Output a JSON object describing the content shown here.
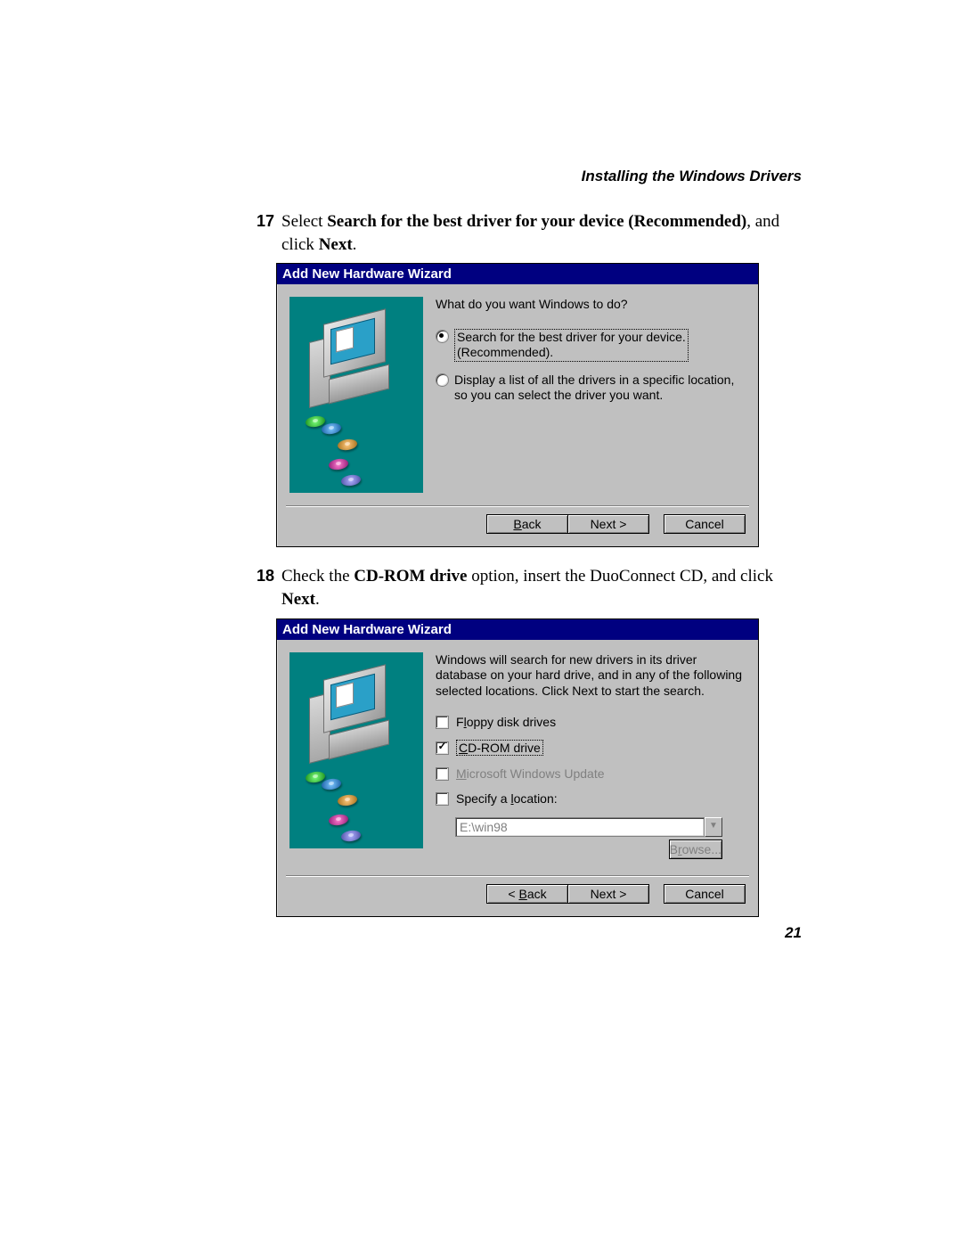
{
  "header": {
    "title": "Installing the Windows Drivers"
  },
  "step17": {
    "num": "17",
    "pre": "Select ",
    "bold1": "Search for the best driver for your device (Recommended)",
    "mid": ", and click ",
    "bold2": "Next",
    "post": "."
  },
  "wizard1": {
    "title": "Add New Hardware Wizard",
    "prompt": "What do you want Windows to do?",
    "opt1_line1": "Search for the best driver for your device.",
    "opt1_line2": "(Recommended).",
    "opt2": "Display a list of all the drivers in a specific location, so you can select the driver you want.",
    "back": "< Back",
    "next": "Next >",
    "cancel": "Cancel"
  },
  "step18": {
    "num": "18",
    "pre": "Check the ",
    "bold1": "CD-ROM drive",
    "mid": " option, insert the DuoConnect CD, and click ",
    "bold2": "Next",
    "post": "."
  },
  "wizard2": {
    "title": "Add New Hardware Wizard",
    "prompt": "Windows will search for new drivers in its driver database on your hard drive, and in any of the following selected locations. Click Next to start the search.",
    "chk_floppy_pre": "F",
    "chk_floppy_und": "l",
    "chk_floppy_post": "oppy disk drives",
    "chk_cd_und": "C",
    "chk_cd_post": "D-ROM drive",
    "chk_msupd_pre": "",
    "chk_msupd_und": "M",
    "chk_msupd_post": "icrosoft Windows Update",
    "chk_spec_pre": "Specify a ",
    "chk_spec_und": "l",
    "chk_spec_post": "ocation:",
    "location_value": "E:\\win98",
    "browse": "Browse...",
    "back": "< Back",
    "next": "Next >",
    "cancel": "Cancel"
  },
  "page_number": "21"
}
